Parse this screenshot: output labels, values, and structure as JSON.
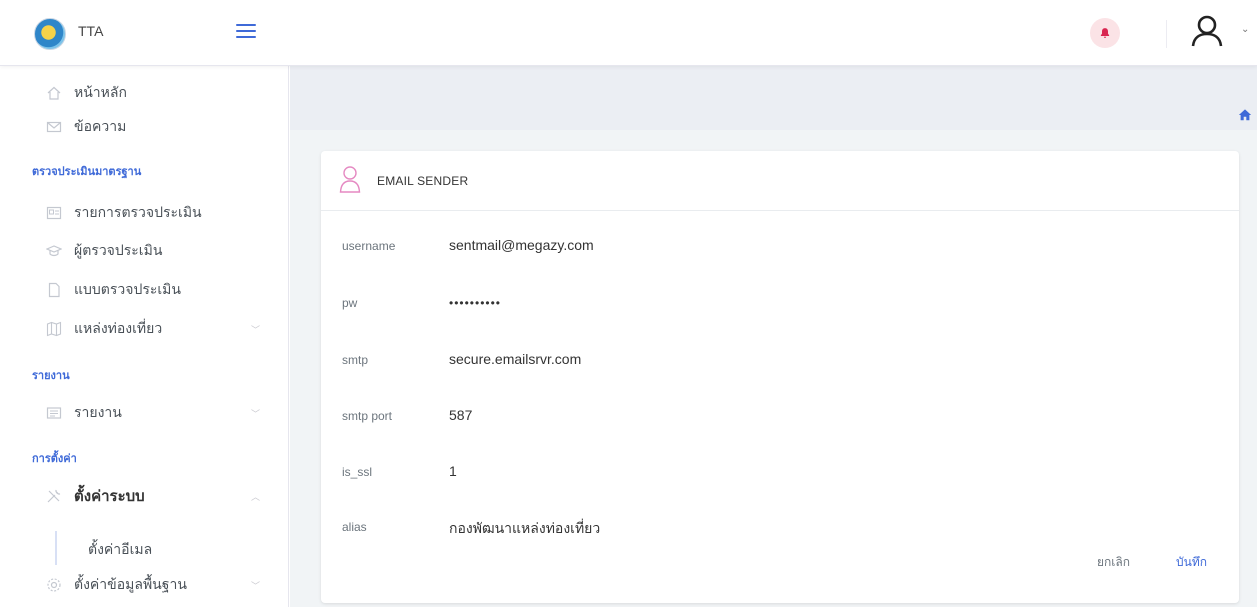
{
  "header": {
    "brand": "TTA"
  },
  "sidebar": {
    "items_top": [
      {
        "label": "หน้าหลัก",
        "icon": "home-icon"
      },
      {
        "label": "ข้อความ",
        "icon": "envelope-icon"
      }
    ],
    "section_assess": "ตรวจประเมินมาตรฐาน",
    "items_assess": [
      {
        "label": "รายการตรวจประเมิน",
        "icon": "id-card-icon"
      },
      {
        "label": "ผู้ตรวจประเมิน",
        "icon": "graduation-cap-icon"
      },
      {
        "label": "แบบตรวจประเมิน",
        "icon": "document-icon"
      },
      {
        "label": "แหล่งท่องเที่ยว",
        "icon": "map-icon"
      }
    ],
    "section_report": "รายงาน",
    "items_report": [
      {
        "label": "รายงาน",
        "icon": "news-icon"
      }
    ],
    "section_settings": "การตั้งค่า",
    "items_settings": [
      {
        "label": "ตั้งค่าระบบ",
        "icon": "tools-icon"
      },
      {
        "label": "ตั้งค่าอีเมล",
        "icon": ""
      },
      {
        "label": "ตั้งค่าข้อมูลพื้นฐาน",
        "icon": "gear-icon"
      }
    ]
  },
  "card": {
    "title": "EMAIL SENDER",
    "fields": [
      {
        "key": "username",
        "value": "sentmail@megazy.com"
      },
      {
        "key": "pw",
        "value": "••••••••••"
      },
      {
        "key": "smtp",
        "value": "secure.emailsrvr.com"
      },
      {
        "key": "smtp port",
        "value": "587"
      },
      {
        "key": "is_ssl",
        "value": "1"
      },
      {
        "key": "alias",
        "value": "กองพัฒนาแหล่งท่องเที่ยว"
      }
    ],
    "cancel_label": "ยกเลิก",
    "save_label": "บันทึก"
  },
  "colors": {
    "accent": "#3f6ad8",
    "bell_bg": "#fbe3e6",
    "bell": "#d92550",
    "user_icon": "#e589c2"
  }
}
